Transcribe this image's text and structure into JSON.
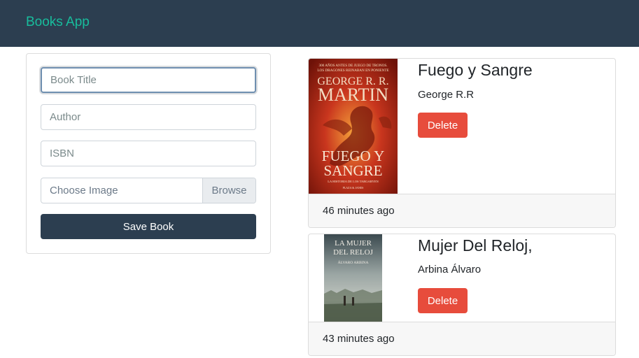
{
  "navbar": {
    "brand": "Books App"
  },
  "form": {
    "title_placeholder": "Book Title",
    "author_placeholder": "Author",
    "isbn_placeholder": "ISBN",
    "image_label": "Choose Image",
    "browse_label": "Browse",
    "save_label": "Save Book"
  },
  "books": [
    {
      "title": "Fuego y Sangre",
      "author": "George R.R",
      "delete_label": "Delete",
      "time": "46 minutes ago",
      "cover": {
        "top_text_1": "300 AÑOS ANTES DE JUEGO DE TRONOS.",
        "top_text_2": "LOS DRAGONES REINABAN EN PONIENTE",
        "author_line_1": "GEORGE R. R.",
        "author_line_2": "MARTIN",
        "title_line_1": "FUEGO Y",
        "title_line_2": "SANGRE",
        "subtitle": "LA HISTORIA DE LOS TARGARYEN",
        "publisher": "PLAZA & JANES"
      }
    },
    {
      "title": "Mujer Del Reloj,",
      "author": "Arbina Álvaro",
      "delete_label": "Delete",
      "time": "43 minutes ago",
      "cover": {
        "title_line_1": "LA MUJER",
        "title_line_2": "DEL RELOJ",
        "author": "ÁLVARO ARBINA"
      }
    }
  ],
  "colors": {
    "navbar": "#2c3e50",
    "brand": "#18bc9c",
    "primary": "#2c3e50",
    "danger": "#e74c3c"
  }
}
